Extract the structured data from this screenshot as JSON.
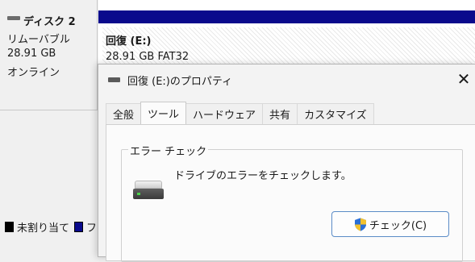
{
  "disk": {
    "name": "ディスク 2",
    "type": "リムーバブル",
    "size": "28.91 GB",
    "status": "オンライン"
  },
  "partition": {
    "name": "回復  (E:)",
    "desc": "28.91 GB FAT32"
  },
  "legend": {
    "unallocated": "未割り当て",
    "primary_partial": "フ"
  },
  "dialog": {
    "title": "回復 (E:)のプロパティ",
    "close": "✕",
    "tabs": [
      {
        "label": "全般"
      },
      {
        "label": "ツール"
      },
      {
        "label": "ハードウェア"
      },
      {
        "label": "共有"
      },
      {
        "label": "カスタマイズ"
      }
    ],
    "active_tab": "ツール",
    "error_check": {
      "group_title": "エラー チェック",
      "description": "ドライブのエラーをチェックします。",
      "button_label": "チェック(C)",
      "button_icon": "uac-shield-icon"
    }
  },
  "colors": {
    "partition_stripe": "#0a0a8c",
    "button_border": "#5b8cc7"
  }
}
